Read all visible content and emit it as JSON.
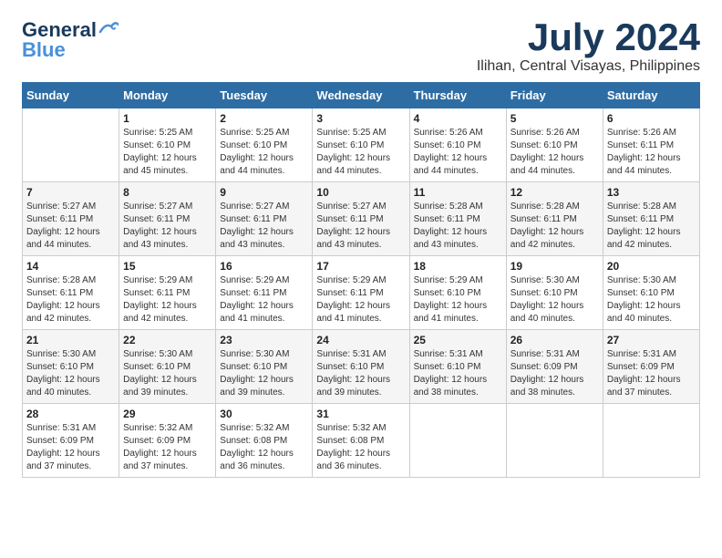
{
  "logo": {
    "line1": "General",
    "line2": "Blue"
  },
  "title": "July 2024",
  "location": "Ilihan, Central Visayas, Philippines",
  "weekdays": [
    "Sunday",
    "Monday",
    "Tuesday",
    "Wednesday",
    "Thursday",
    "Friday",
    "Saturday"
  ],
  "weeks": [
    [
      {
        "day": "",
        "info": ""
      },
      {
        "day": "1",
        "info": "Sunrise: 5:25 AM\nSunset: 6:10 PM\nDaylight: 12 hours\nand 45 minutes."
      },
      {
        "day": "2",
        "info": "Sunrise: 5:25 AM\nSunset: 6:10 PM\nDaylight: 12 hours\nand 44 minutes."
      },
      {
        "day": "3",
        "info": "Sunrise: 5:25 AM\nSunset: 6:10 PM\nDaylight: 12 hours\nand 44 minutes."
      },
      {
        "day": "4",
        "info": "Sunrise: 5:26 AM\nSunset: 6:10 PM\nDaylight: 12 hours\nand 44 minutes."
      },
      {
        "day": "5",
        "info": "Sunrise: 5:26 AM\nSunset: 6:10 PM\nDaylight: 12 hours\nand 44 minutes."
      },
      {
        "day": "6",
        "info": "Sunrise: 5:26 AM\nSunset: 6:11 PM\nDaylight: 12 hours\nand 44 minutes."
      }
    ],
    [
      {
        "day": "7",
        "info": "Sunrise: 5:27 AM\nSunset: 6:11 PM\nDaylight: 12 hours\nand 44 minutes."
      },
      {
        "day": "8",
        "info": "Sunrise: 5:27 AM\nSunset: 6:11 PM\nDaylight: 12 hours\nand 43 minutes."
      },
      {
        "day": "9",
        "info": "Sunrise: 5:27 AM\nSunset: 6:11 PM\nDaylight: 12 hours\nand 43 minutes."
      },
      {
        "day": "10",
        "info": "Sunrise: 5:27 AM\nSunset: 6:11 PM\nDaylight: 12 hours\nand 43 minutes."
      },
      {
        "day": "11",
        "info": "Sunrise: 5:28 AM\nSunset: 6:11 PM\nDaylight: 12 hours\nand 43 minutes."
      },
      {
        "day": "12",
        "info": "Sunrise: 5:28 AM\nSunset: 6:11 PM\nDaylight: 12 hours\nand 42 minutes."
      },
      {
        "day": "13",
        "info": "Sunrise: 5:28 AM\nSunset: 6:11 PM\nDaylight: 12 hours\nand 42 minutes."
      }
    ],
    [
      {
        "day": "14",
        "info": "Sunrise: 5:28 AM\nSunset: 6:11 PM\nDaylight: 12 hours\nand 42 minutes."
      },
      {
        "day": "15",
        "info": "Sunrise: 5:29 AM\nSunset: 6:11 PM\nDaylight: 12 hours\nand 42 minutes."
      },
      {
        "day": "16",
        "info": "Sunrise: 5:29 AM\nSunset: 6:11 PM\nDaylight: 12 hours\nand 41 minutes."
      },
      {
        "day": "17",
        "info": "Sunrise: 5:29 AM\nSunset: 6:11 PM\nDaylight: 12 hours\nand 41 minutes."
      },
      {
        "day": "18",
        "info": "Sunrise: 5:29 AM\nSunset: 6:10 PM\nDaylight: 12 hours\nand 41 minutes."
      },
      {
        "day": "19",
        "info": "Sunrise: 5:30 AM\nSunset: 6:10 PM\nDaylight: 12 hours\nand 40 minutes."
      },
      {
        "day": "20",
        "info": "Sunrise: 5:30 AM\nSunset: 6:10 PM\nDaylight: 12 hours\nand 40 minutes."
      }
    ],
    [
      {
        "day": "21",
        "info": "Sunrise: 5:30 AM\nSunset: 6:10 PM\nDaylight: 12 hours\nand 40 minutes."
      },
      {
        "day": "22",
        "info": "Sunrise: 5:30 AM\nSunset: 6:10 PM\nDaylight: 12 hours\nand 39 minutes."
      },
      {
        "day": "23",
        "info": "Sunrise: 5:30 AM\nSunset: 6:10 PM\nDaylight: 12 hours\nand 39 minutes."
      },
      {
        "day": "24",
        "info": "Sunrise: 5:31 AM\nSunset: 6:10 PM\nDaylight: 12 hours\nand 39 minutes."
      },
      {
        "day": "25",
        "info": "Sunrise: 5:31 AM\nSunset: 6:10 PM\nDaylight: 12 hours\nand 38 minutes."
      },
      {
        "day": "26",
        "info": "Sunrise: 5:31 AM\nSunset: 6:09 PM\nDaylight: 12 hours\nand 38 minutes."
      },
      {
        "day": "27",
        "info": "Sunrise: 5:31 AM\nSunset: 6:09 PM\nDaylight: 12 hours\nand 37 minutes."
      }
    ],
    [
      {
        "day": "28",
        "info": "Sunrise: 5:31 AM\nSunset: 6:09 PM\nDaylight: 12 hours\nand 37 minutes."
      },
      {
        "day": "29",
        "info": "Sunrise: 5:32 AM\nSunset: 6:09 PM\nDaylight: 12 hours\nand 37 minutes."
      },
      {
        "day": "30",
        "info": "Sunrise: 5:32 AM\nSunset: 6:08 PM\nDaylight: 12 hours\nand 36 minutes."
      },
      {
        "day": "31",
        "info": "Sunrise: 5:32 AM\nSunset: 6:08 PM\nDaylight: 12 hours\nand 36 minutes."
      },
      {
        "day": "",
        "info": ""
      },
      {
        "day": "",
        "info": ""
      },
      {
        "day": "",
        "info": ""
      }
    ]
  ]
}
